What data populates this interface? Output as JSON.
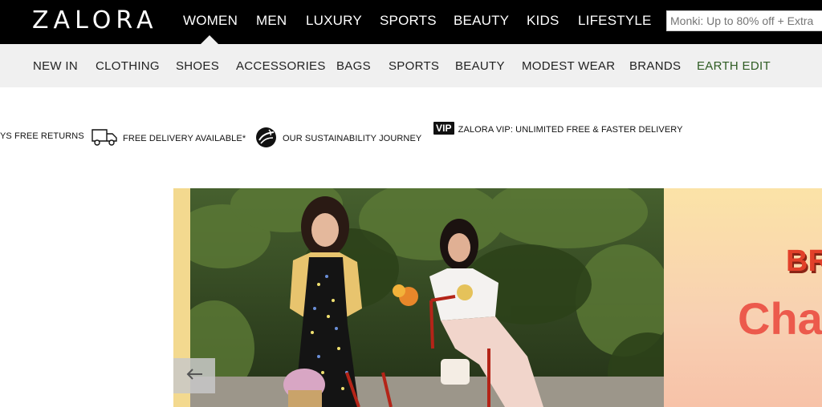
{
  "brand": {
    "logo": "ZALORA"
  },
  "main_nav": {
    "items": [
      "WOMEN",
      "MEN",
      "LUXURY",
      "SPORTS",
      "BEAUTY",
      "KIDS",
      "LIFESTYLE"
    ],
    "active": "WOMEN"
  },
  "search": {
    "placeholder": "Monki: Up to 80% off + Extra"
  },
  "sub_nav": {
    "items": [
      "NEW IN",
      "CLOTHING",
      "SHOES",
      "ACCESSORIES",
      "BAGS",
      "SPORTS",
      "BEAUTY",
      "MODEST WEAR",
      "BRANDS",
      "EARTH EDIT"
    ],
    "highlight_color": "#2e5b22"
  },
  "usp": {
    "returns": "YS FREE RETURNS",
    "delivery": "FREE DELIVERY AVAILABLE*",
    "sustainability": "OUR SUSTAINABILITY JOURNEY",
    "vip_badge": "VIP",
    "vip": "ZALORA VIP: UNLIMITED FREE & FASTER DELIVERY"
  },
  "hero": {
    "promo_partial_1": "BR",
    "promo_partial_2": "Cha",
    "prev_icon": "arrow-left-icon"
  },
  "colors": {
    "topbar": "#000000",
    "subnav_bg": "#f0f0f0",
    "promo_red": "#ec5a4c"
  }
}
